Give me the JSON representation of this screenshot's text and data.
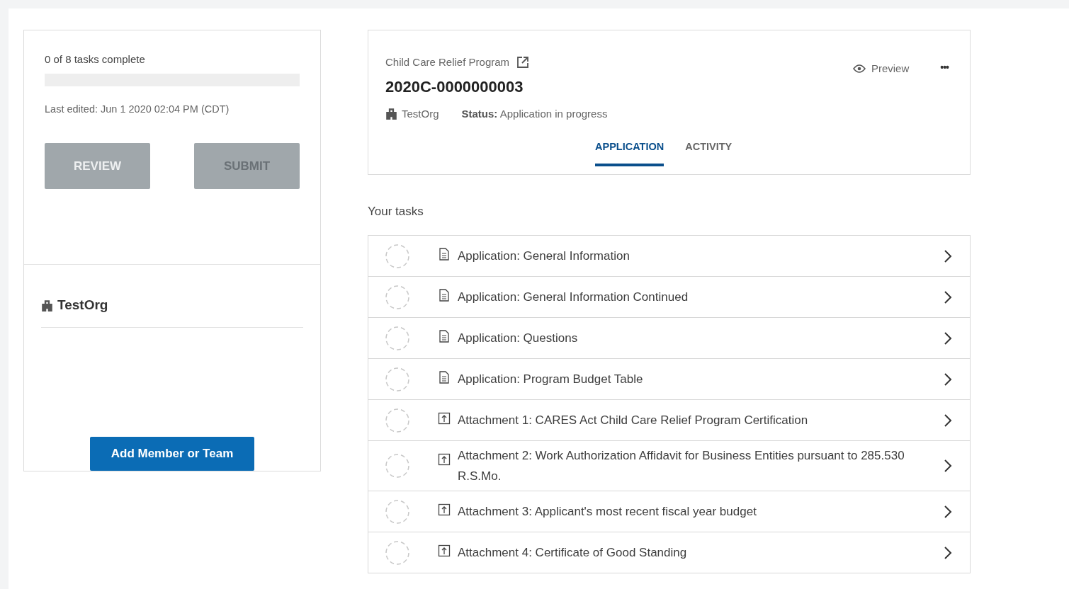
{
  "progress": {
    "summary": "0 of 8 tasks complete",
    "level": 0,
    "last_edited": "Last edited: Jun 1 2020 02:04 PM (CDT)"
  },
  "actions": [
    {
      "label": "REVIEW",
      "disabled": false
    },
    {
      "label": "SUBMIT",
      "disabled": true
    }
  ],
  "organization": {
    "name": "TestOrg",
    "add_button": "Add Member or Team"
  },
  "header": {
    "program": "Child Care Relief Program",
    "preview": "Preview",
    "more": "•••",
    "application_id": "2020C-0000000003",
    "org": "TestOrg",
    "status_label": "Status:",
    "status": "Application in progress"
  },
  "tabs": [
    {
      "label": "APPLICATION",
      "selected": true
    },
    {
      "label": "ACTIVITY",
      "selected": false
    }
  ],
  "tasks_title": "Your tasks",
  "tasks": [
    {
      "kind": "form",
      "title": "Application: General Information",
      "complete": false
    },
    {
      "kind": "form",
      "title": "Application: General Information Continued",
      "complete": false
    },
    {
      "kind": "form",
      "title": "Application: Questions",
      "complete": false
    },
    {
      "kind": "form",
      "title": "Application: Program Budget Table",
      "complete": false
    },
    {
      "kind": "upload",
      "title": "Attachment 1: CARES Act Child Care Relief Program Certification",
      "complete": false
    },
    {
      "kind": "upload",
      "title": "Attachment 2: Work Authorization Affidavit for Business Entities pursuant to 285.530 R.S.Mo.",
      "complete": false
    },
    {
      "kind": "upload",
      "title": "Attachment 3: Applicant's most recent fiscal year budget",
      "complete": false
    },
    {
      "kind": "upload",
      "title": "Attachment 4: Certificate of Good Standing",
      "complete": false
    }
  ]
}
